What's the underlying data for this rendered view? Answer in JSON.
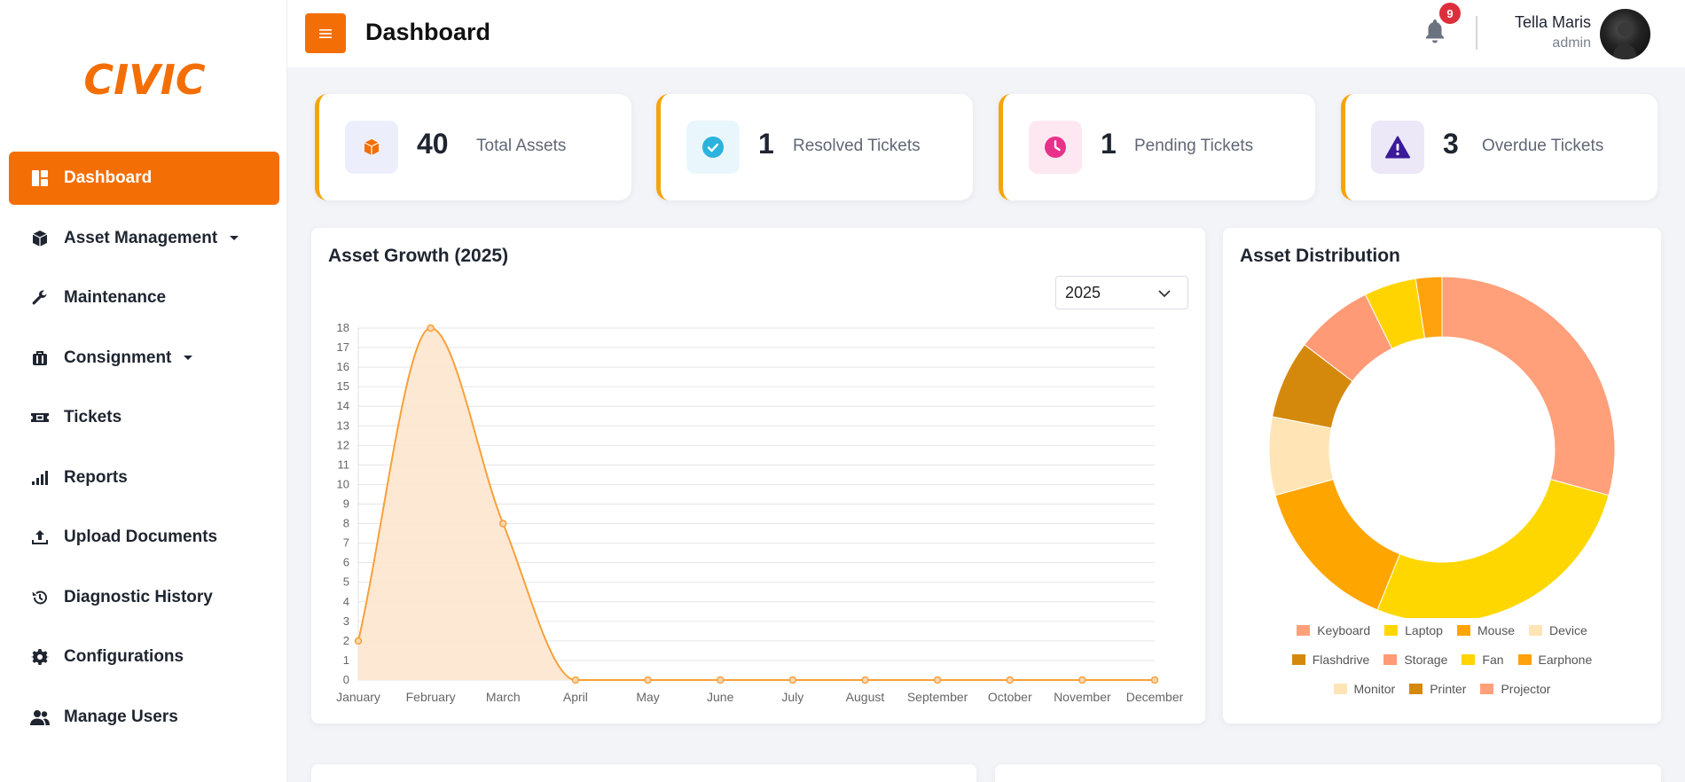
{
  "brand": {
    "logo_text": "CIVIC",
    "accent": "#f36f05"
  },
  "sidebar": {
    "items": [
      {
        "label": "Dashboard",
        "icon": "dashboard-icon",
        "active": true,
        "has_caret": false
      },
      {
        "label": "Asset Management",
        "icon": "box-icon",
        "active": false,
        "has_caret": true
      },
      {
        "label": "Maintenance",
        "icon": "wrench-icon",
        "active": false,
        "has_caret": false
      },
      {
        "label": "Consignment",
        "icon": "briefcase-icon",
        "active": false,
        "has_caret": true
      },
      {
        "label": "Tickets",
        "icon": "ticket-icon",
        "active": false,
        "has_caret": false
      },
      {
        "label": "Reports",
        "icon": "signal-bars-icon",
        "active": false,
        "has_caret": false
      },
      {
        "label": "Upload Documents",
        "icon": "upload-icon",
        "active": false,
        "has_caret": false
      },
      {
        "label": "Diagnostic History",
        "icon": "history-icon",
        "active": false,
        "has_caret": false
      },
      {
        "label": "Configurations",
        "icon": "gear-icon",
        "active": false,
        "has_caret": false
      },
      {
        "label": "Manage Users",
        "icon": "users-icon",
        "active": false,
        "has_caret": false
      }
    ]
  },
  "header": {
    "title": "Dashboard",
    "notification_count": "9",
    "user": {
      "name": "Tella Maris",
      "role": "admin"
    }
  },
  "stats": [
    {
      "value": "40",
      "label": "Total Assets",
      "icon": "box-icon",
      "icon_color": "#f36f05",
      "icon_bg": "#eceffb"
    },
    {
      "value": "1",
      "label": "Resolved Tickets",
      "icon": "check-circle-icon",
      "icon_color": "#2bb3dd",
      "icon_bg": "#e9f7fd"
    },
    {
      "value": "1",
      "label": "Pending Tickets",
      "icon": "clock-icon",
      "icon_color": "#e8318a",
      "icon_bg": "#fde8f1"
    },
    {
      "value": "3",
      "label": "Overdue Tickets",
      "icon": "warning-icon",
      "icon_color": "#3b1b9a",
      "icon_bg": "#ece8f8"
    }
  ],
  "growth_panel": {
    "title": "Asset Growth (2025)",
    "selected_year": "2025"
  },
  "distribution_panel": {
    "title": "Asset Distribution"
  },
  "chart_data": [
    {
      "type": "area",
      "title": "Asset Growth (2025)",
      "categories": [
        "January",
        "February",
        "March",
        "April",
        "May",
        "June",
        "July",
        "August",
        "September",
        "October",
        "November",
        "December"
      ],
      "values": [
        2,
        18,
        8,
        0,
        0,
        0,
        0,
        0,
        0,
        0,
        0,
        0
      ],
      "ylim": [
        0,
        18
      ],
      "yticks": [
        0,
        1,
        2,
        3,
        4,
        5,
        6,
        7,
        8,
        9,
        10,
        11,
        12,
        13,
        14,
        15,
        16,
        17,
        18
      ],
      "grid": true,
      "line_color": "#f7a13a",
      "fill_color": "#fde5cf"
    },
    {
      "type": "pie",
      "title": "Asset Distribution",
      "donut": true,
      "categories": [
        "Keyboard",
        "Laptop",
        "Mouse",
        "Device",
        "Flashdrive",
        "Storage",
        "Fan",
        "Earphone",
        "Monitor",
        "Printer",
        "Projector"
      ],
      "values": [
        12,
        11,
        6,
        3,
        3,
        3,
        2,
        1,
        0,
        0,
        0
      ],
      "colors": [
        "#ffa07a",
        "#ffd700",
        "#ffa500",
        "#ffe4b5",
        "#d4890c",
        "#ff9a76",
        "#ffd400",
        "#ffa20e",
        "#ffe4b5",
        "#d4890c",
        "#ffa07a"
      ],
      "legend_position": "bottom"
    }
  ]
}
